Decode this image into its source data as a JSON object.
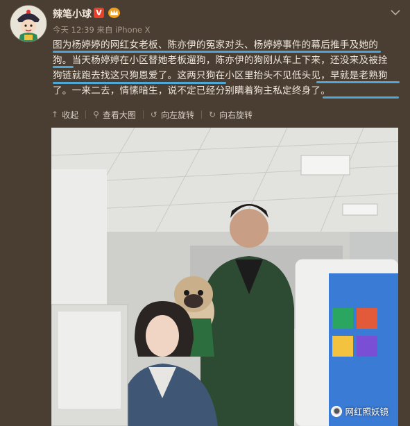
{
  "post": {
    "username": "辣笔小球",
    "verified_badge": "V",
    "timestamp": "今天 12:39",
    "source_prefix": "来自",
    "source": "iPhone X",
    "text_lines": [
      "图为杨婷婷的网红女老板、陈亦伊的冤家对头、杨婷婷事件的幕后推手及她的",
      "狗。当天杨婷婷在小区替她老板遛狗，陈亦伊的狗刚从车上下来，还没来及被拴",
      "狗链就跑去找这只狗恩爱了。这两只狗在小区里抬头不见低头见，早就是老熟狗",
      "了。一来二去，情愫暗生，说不定已经分别瞒着狗主私定终身了。"
    ]
  },
  "actions": [
    {
      "icon": "collapse-arrow-icon",
      "label": "收起"
    },
    {
      "icon": "zoom-icon",
      "label": "查看大图"
    },
    {
      "icon": "rotate-left-icon",
      "label": "向左旋转"
    },
    {
      "icon": "rotate-right-icon",
      "label": "向右旋转"
    }
  ],
  "image": {
    "watermark": "网红照妖镜"
  },
  "colors": {
    "background": "#4a3d32",
    "underline": "#4fa7d8",
    "verified": "#e8412b"
  }
}
